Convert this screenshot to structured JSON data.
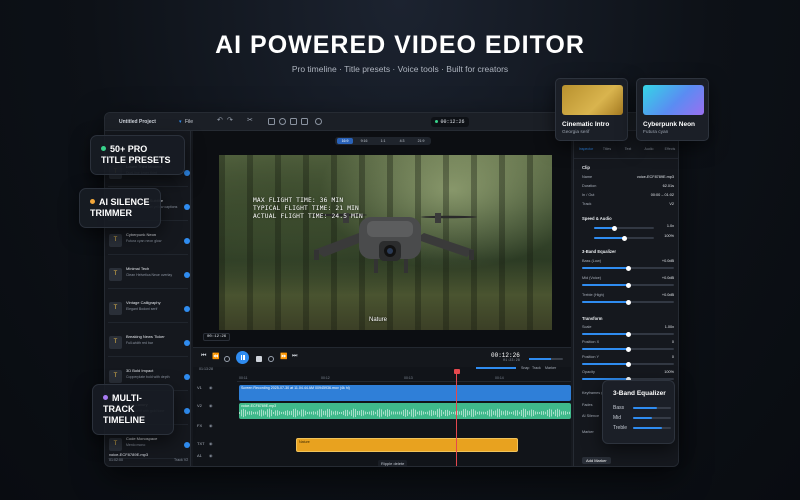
{
  "hero": {
    "title": "AI POWERED VIDEO EDITOR",
    "subtitle": "Pro timeline · Title presets · Voice tools · Built for creators"
  },
  "toolbar": {
    "project": "Untitled Project",
    "file_menu": "File",
    "timecode": "00:12:26"
  },
  "left_list": [
    {
      "name": "Lower Third Modern",
      "desc": "Dual-line lower third",
      "glyph": "T"
    },
    {
      "name": "Social Name Subtitle",
      "desc": "Ultra-bold Impact yellow captions",
      "glyph": "T"
    },
    {
      "name": "Cyberpunk Neon",
      "desc": "Futura cyan neon glow",
      "glyph": "T"
    },
    {
      "name": "Minimal Tech",
      "desc": "Clean Helvetica Neue overlay",
      "glyph": "T"
    },
    {
      "name": "Vintage Calligraphy",
      "desc": "Elegant Bodoni serif",
      "glyph": "T"
    },
    {
      "name": "Breaking News Ticker",
      "desc": "Full-width red bar",
      "glyph": "T"
    },
    {
      "name": "3D Bold Impact",
      "desc": "Copperplate bold with depth",
      "glyph": "T"
    },
    {
      "name": "Gold Luxury",
      "desc": "Didot serif with gold tone",
      "glyph": "♛"
    },
    {
      "name": "Code Monospace",
      "desc": "Menlo mono",
      "glyph": "T"
    }
  ],
  "left_footer": {
    "file": "voice-ECF8789E.mp3",
    "duration": "01:02:00",
    "track": "Track V2"
  },
  "viewer": {
    "ratio_tabs": [
      "16:9",
      "9:16",
      "1:1",
      "4:3",
      "21:9"
    ],
    "overlay_lines": [
      "MAX FLIGHT TIME: 36 MIN",
      "TYPICAL FLIGHT TIME: 21 MIN",
      "ACTUAL FLIGHT TIME: 24.5 MIN"
    ],
    "caption": "Nature",
    "stamp": "00:12:26"
  },
  "transport": {
    "timecode": "00:12:26",
    "total": "01:23:28"
  },
  "timeline": {
    "time_label": "01:13:28",
    "ruler": [
      "00:11",
      "00:12",
      "00:13",
      "00:14"
    ],
    "tracks": [
      {
        "name": "V1"
      },
      {
        "name": "V2"
      },
      {
        "name": "FX"
      },
      {
        "name": "TXT"
      },
      {
        "name": "A1"
      }
    ],
    "clips": {
      "v1": "Screen Recording 2025-07-30 at 11.04.44 AM 00945936.mov (4k hi)",
      "v2": "voice-ECF8789E.mp3",
      "txt": "Nature"
    },
    "ripple": "Ripple delete",
    "snap": "Snap",
    "track_btn": "Track",
    "marker_btn": "Marker"
  },
  "inspector": {
    "tabs": [
      "Inspector",
      "Titles",
      "Text",
      "Audio",
      "Effects"
    ],
    "clip_section": "Clip",
    "clip": [
      {
        "label": "Name",
        "value": "voice-ECF8789E.mp3"
      },
      {
        "label": "Duration",
        "value": "62.01s"
      },
      {
        "label": "In / Out",
        "value": "00:00 – 01:02"
      },
      {
        "label": "Track",
        "value": "V2"
      }
    ],
    "speed_section": "Speed & Audio",
    "speed_value": "1.0x",
    "volume_value": "100%",
    "eq_section": "3-Band Equalizer",
    "eq_rows": [
      {
        "label": "Bass (Low)",
        "value": "+0.0dB"
      },
      {
        "label": "Mid (Voice)",
        "value": "+0.0dB"
      },
      {
        "label": "Treble (High)",
        "value": "+0.0dB"
      }
    ],
    "transform_section": "Transform",
    "transform_rows": [
      {
        "label": "Scale",
        "value": "1.00x"
      },
      {
        "label": "Position X",
        "value": "0"
      },
      {
        "label": "Position Y",
        "value": "0"
      },
      {
        "label": "Opacity",
        "value": "100%"
      }
    ],
    "keyframes_label": "Keyframes (0)",
    "fades_label": "Fades",
    "silence_label": "AI Silence",
    "marker_label": "Marker",
    "add_marker": "Add Marker"
  },
  "callouts": {
    "titles": "50+ PRO TITLE PRESETS",
    "silence": "AI SILENCE TRIMMER",
    "multitrack": "MULTI-TRACK TIMELINE"
  },
  "presets": [
    {
      "name": "Cinematic Intro",
      "desc": "Georgia serif"
    },
    {
      "name": "Cyberpunk Neon",
      "desc": "Futura cyan"
    }
  ],
  "eq_card": {
    "title": "3-Band Equalizer",
    "bands": [
      {
        "label": "Bass",
        "level": 0.62
      },
      {
        "label": "Mid",
        "level": 0.5
      },
      {
        "label": "Treble",
        "level": 0.75
      }
    ]
  },
  "colors": {
    "accent": "#2f8cf0",
    "playhead": "#e5484d",
    "audio_clip": "#3fb98b",
    "text_clip": "#e8a21f",
    "video_clip": "#2f7fd8"
  }
}
